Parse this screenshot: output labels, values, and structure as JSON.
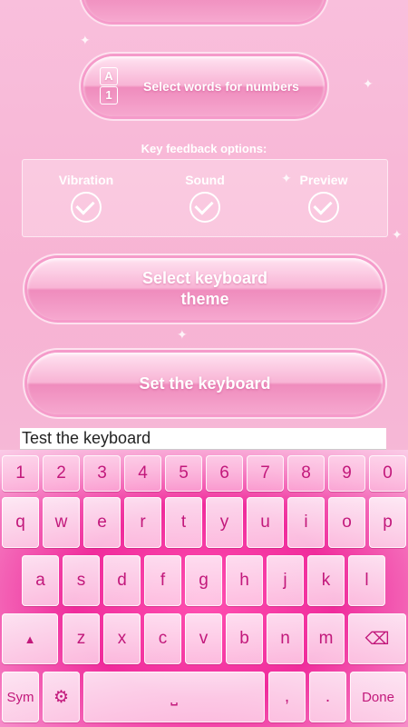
{
  "buttons": {
    "words_for_numbers": "Select words for numbers",
    "a1_top": "A",
    "a1_bottom": "1",
    "select_theme_line1": "Select keyboard",
    "select_theme_line2": "theme",
    "set_keyboard": "Set the keyboard"
  },
  "feedback": {
    "title": "Key feedback options:",
    "options": [
      {
        "label": "Vibration",
        "checked": true
      },
      {
        "label": "Sound",
        "checked": true
      },
      {
        "label": "Preview",
        "checked": true
      }
    ]
  },
  "test_field": {
    "value": "Test the keyboard"
  },
  "keyboard": {
    "row_numbers": [
      "1",
      "2",
      "3",
      "4",
      "5",
      "6",
      "7",
      "8",
      "9",
      "0"
    ],
    "row_top": [
      "q",
      "w",
      "e",
      "r",
      "t",
      "y",
      "u",
      "i",
      "o",
      "p"
    ],
    "row_mid": [
      "a",
      "s",
      "d",
      "f",
      "g",
      "h",
      "j",
      "k",
      "l"
    ],
    "row_bottom": [
      "z",
      "x",
      "c",
      "v",
      "b",
      "n",
      "m"
    ],
    "sym_label": "Sym",
    "comma": ",",
    "period": ".",
    "done_label": "Done"
  },
  "colors": {
    "accent": "#f02c9c",
    "key_text": "#c2187b"
  }
}
